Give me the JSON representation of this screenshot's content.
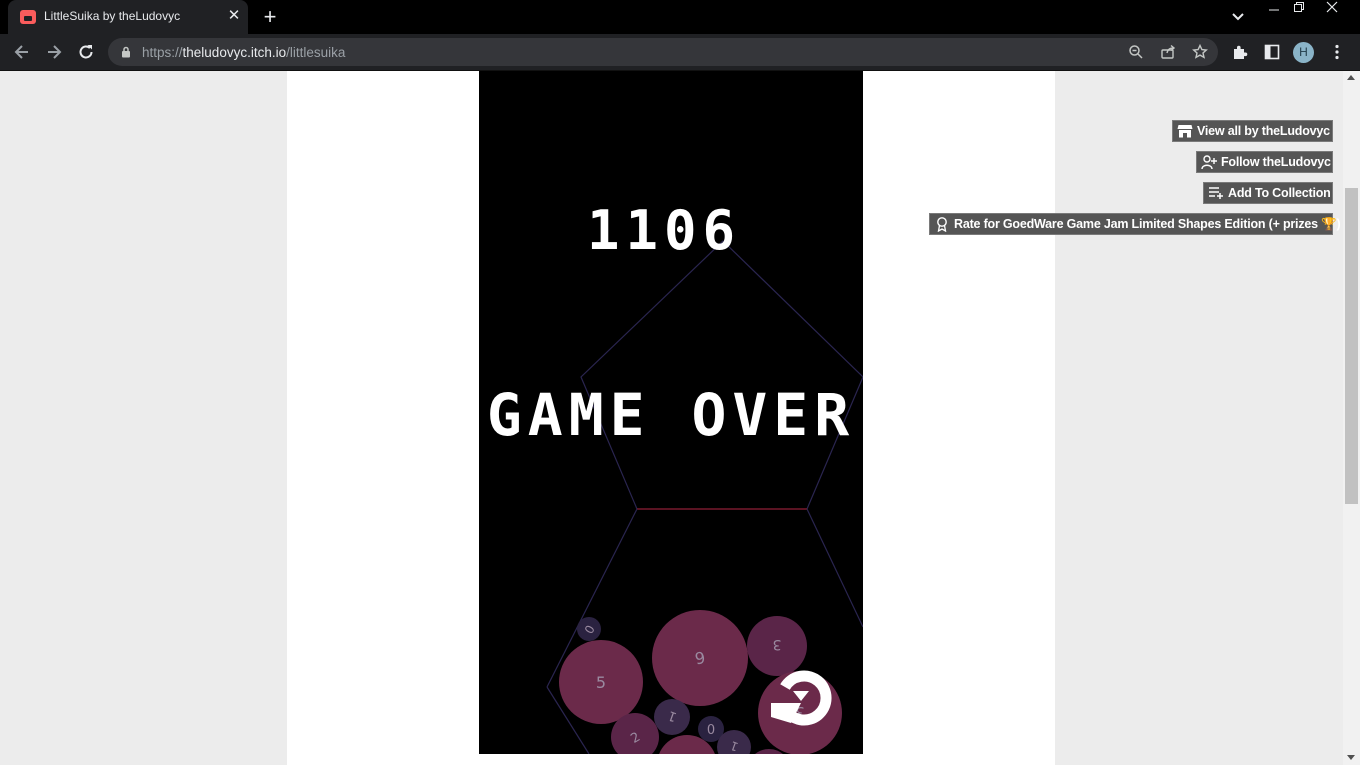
{
  "browser": {
    "tab_title": "LittleSuika by theLudovyc",
    "tab_close_glyph": "✕",
    "new_tab_glyph": "+",
    "url_host": "theludovyc.itch.io",
    "url_prefix": "https://",
    "url_path": "/littlesuika",
    "profile_initial": "H"
  },
  "game": {
    "score": "1106",
    "status": "GAME OVER",
    "balls": [
      {
        "label": "5"
      },
      {
        "label": "6"
      },
      {
        "label": "3"
      },
      {
        "label": "0"
      },
      {
        "label": "1"
      },
      {
        "label": "0"
      },
      {
        "label": "2"
      },
      {
        "label": "1"
      },
      {
        "label": "3"
      }
    ]
  },
  "sidebar_buttons": {
    "view_all": "View all by theLudovyc",
    "follow": "Follow theLudovyc",
    "add_collection": "Add To Collection",
    "rate": "Rate for GoedWare Game Jam Limited Shapes Edition (+ prizes 🏆)"
  },
  "colors": {
    "ball_fill": "#6b2a4a",
    "ball_small_fill": "#3a2a4a",
    "pentagon_stroke": "#2a2550",
    "danger_line": "#8a1a2a"
  }
}
